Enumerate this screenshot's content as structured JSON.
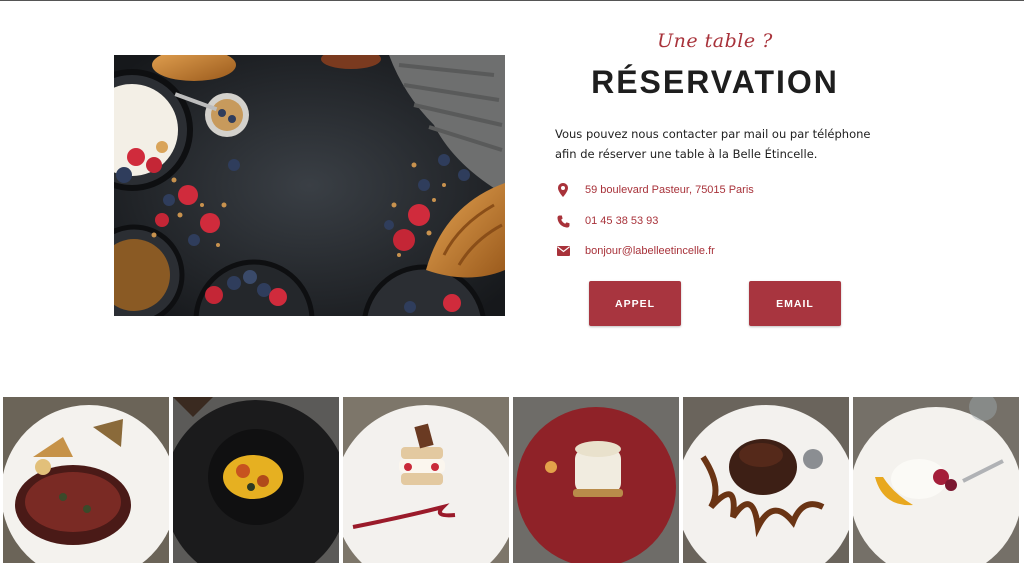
{
  "reservation": {
    "kicker": "Une table ?",
    "title": "RÉSERVATION",
    "intro": "Vous pouvez nous contacter par mail ou par téléphone afin de réserver une table à la Belle Étincelle.",
    "address": "59 boulevard Pasteur, 75015 Paris",
    "phone": "01 45 38 53 93",
    "email": "bonjour@labelleetincelle.fr",
    "call_label": "APPEL",
    "email_label": "EMAIL"
  },
  "icons": {
    "address": "map-marker-icon",
    "phone": "phone-icon",
    "email": "envelope-icon"
  },
  "colors": {
    "accent": "#a8323a",
    "button": "#a8353f",
    "text": "#222222"
  },
  "hero_image": "breakfast-flat-lay-photo",
  "gallery": [
    "steak-plate-photo",
    "dark-bowl-dish-photo",
    "strawberry-millefeuille-photo",
    "cheesecake-photo",
    "chocolate-fondant-photo",
    "pavlova-dessert-photo"
  ]
}
